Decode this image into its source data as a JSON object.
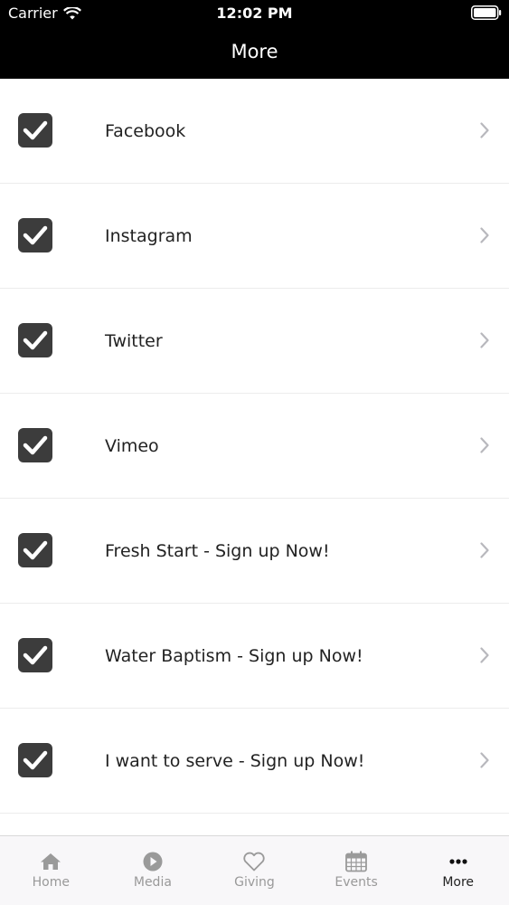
{
  "status_bar": {
    "carrier": "Carrier",
    "time": "12:02 PM"
  },
  "header": {
    "title": "More"
  },
  "list": {
    "items": [
      {
        "label": "Facebook",
        "checked": true
      },
      {
        "label": "Instagram",
        "checked": true
      },
      {
        "label": "Twitter",
        "checked": true
      },
      {
        "label": "Vimeo",
        "checked": true
      },
      {
        "label": "Fresh Start - Sign up Now!",
        "checked": true
      },
      {
        "label": "Water Baptism - Sign up Now!",
        "checked": true
      },
      {
        "label": "I want to serve - Sign up Now!",
        "checked": true
      }
    ]
  },
  "tab_bar": {
    "tabs": [
      {
        "label": "Home",
        "icon": "home-icon",
        "active": false
      },
      {
        "label": "Media",
        "icon": "play-icon",
        "active": false
      },
      {
        "label": "Giving",
        "icon": "heart-icon",
        "active": false
      },
      {
        "label": "Events",
        "icon": "calendar-icon",
        "active": false
      },
      {
        "label": "More",
        "icon": "more-dots-icon",
        "active": true
      }
    ]
  },
  "colors": {
    "header_bg": "#000000",
    "checkbox_bg": "#3c3c3c",
    "tab_inactive": "#999999",
    "tab_active": "#222222"
  }
}
